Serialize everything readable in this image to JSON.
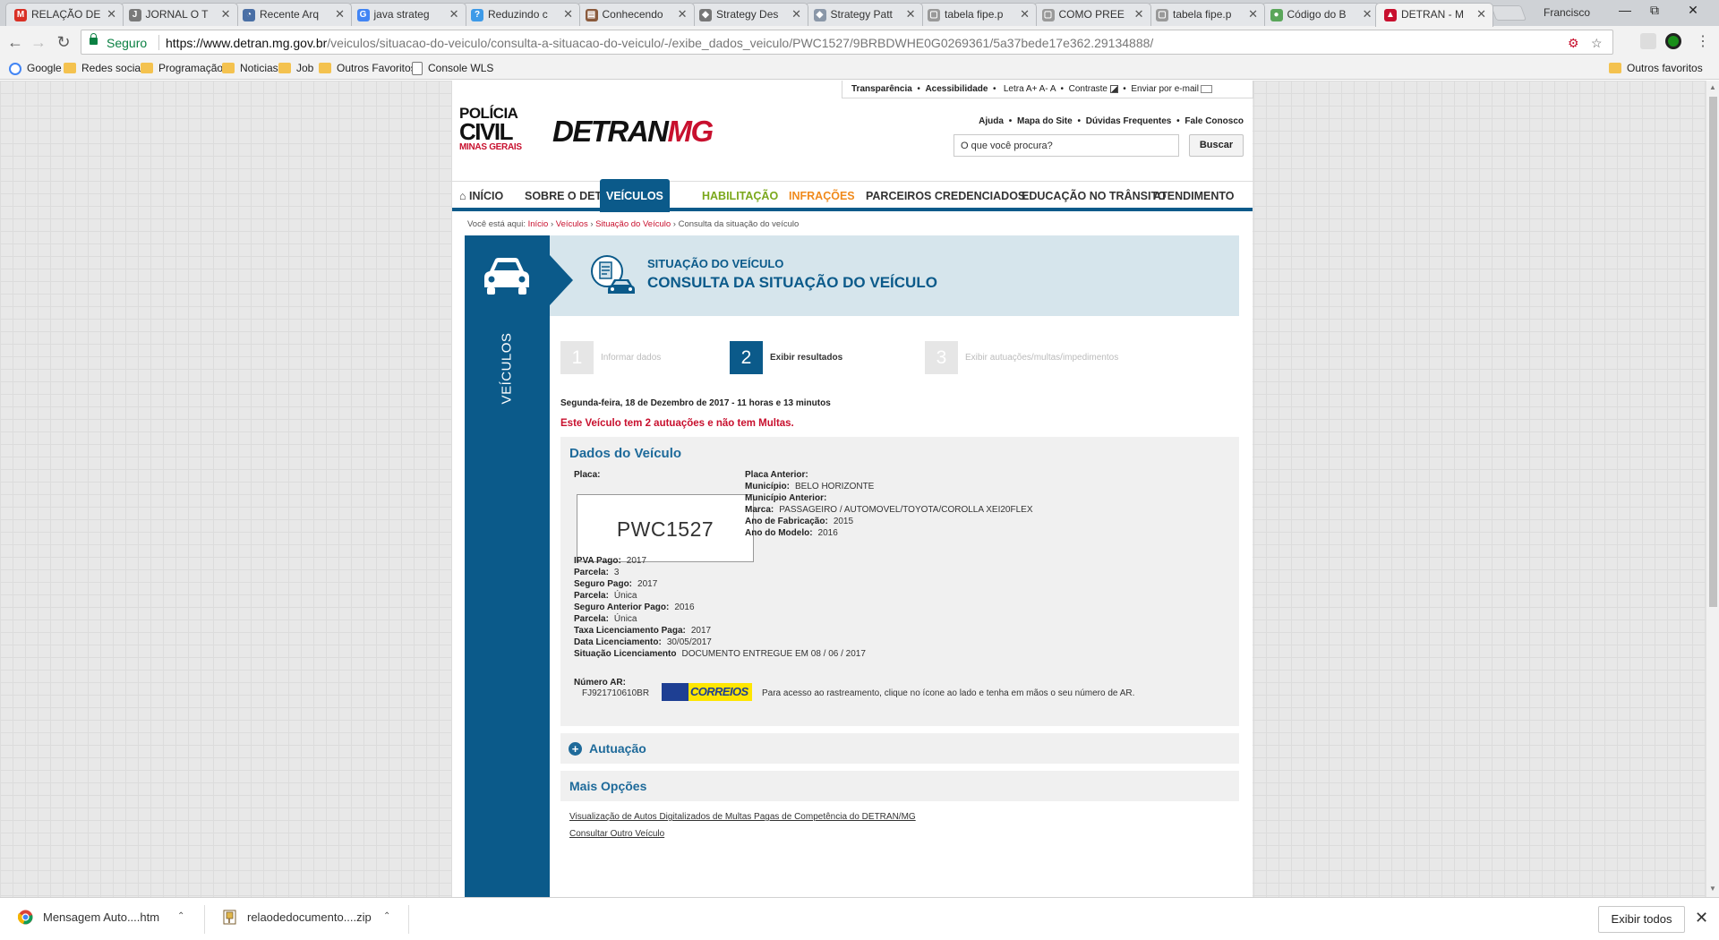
{
  "browser": {
    "tabs": [
      {
        "title": "RELAÇÃO DE",
        "icon": "gmail-icon",
        "glyph": "M",
        "color": "#d93025"
      },
      {
        "title": "JORNAL O T",
        "icon": "page-icon",
        "glyph": "J",
        "color": "#7a7a7a"
      },
      {
        "title": "Recente Arq",
        "icon": "drive-icon",
        "glyph": "◔",
        "color": "#4a6fa5"
      },
      {
        "title": "java strateg",
        "icon": "google-icon",
        "glyph": "G",
        "color": "#4285f4"
      },
      {
        "title": "Reduzindo c",
        "icon": "doc-icon",
        "glyph": "?",
        "color": "#3d9ae8"
      },
      {
        "title": "Conhecendo",
        "icon": "book-icon",
        "glyph": "▤",
        "color": "#8a5a3c"
      },
      {
        "title": "Strategy Des",
        "icon": "pattern-icon",
        "glyph": "◆",
        "color": "#777777"
      },
      {
        "title": "Strategy Patt",
        "icon": "pattern-icon",
        "glyph": "◆",
        "color": "#8a97a8"
      },
      {
        "title": "tabela fipe.p",
        "icon": "file-icon",
        "glyph": "▢",
        "color": "#999999"
      },
      {
        "title": "COMO PREE",
        "icon": "file-icon",
        "glyph": "▢",
        "color": "#999999"
      },
      {
        "title": "tabela fipe.p",
        "icon": "file-icon",
        "glyph": "▢",
        "color": "#999999"
      },
      {
        "title": "Código do B",
        "icon": "globe-icon",
        "glyph": "●",
        "color": "#5aa65a"
      },
      {
        "title": "DETRAN - M",
        "icon": "detran-icon",
        "glyph": "▲",
        "color": "#c8102e"
      }
    ],
    "profile_name": "Francisco",
    "secure_label": "Seguro",
    "url_domain": "https://www.detran.mg.gov.br",
    "url_path": "/veiculos/situacao-do-veiculo/consulta-a-situacao-do-veiculo/-/exibe_dados_veiculo/PWC1527/9BRBDWHE0G0269361/5a37bede17e362.29134888/",
    "bookmarks": [
      {
        "label": "Google",
        "kind": "google"
      },
      {
        "label": "Redes sociais",
        "kind": "folder"
      },
      {
        "label": "Programação",
        "kind": "folder"
      },
      {
        "label": "Noticias",
        "kind": "folder"
      },
      {
        "label": "Job",
        "kind": "folder"
      },
      {
        "label": "Outros Favoritos",
        "kind": "folder"
      },
      {
        "label": "Console WLS",
        "kind": "page"
      }
    ],
    "other_bookmarks": "Outros favoritos"
  },
  "site": {
    "toplinks": {
      "transparencia": "Transparência",
      "acessibilidade": "Acessibilidade",
      "letra": "Letra A+ A- A",
      "contraste": "Contraste",
      "email": "Enviar por e-mail"
    },
    "logo": {
      "pc_line1": "POLÍCIA",
      "pc_line2": "CIVIL",
      "pc_line3": "MINAS GERAIS",
      "detran_a": "DETRAN",
      "detran_b": "MG"
    },
    "helplinks": [
      "Ajuda",
      "Mapa do Site",
      "Dúvidas Frequentes",
      "Fale Conosco"
    ],
    "search": {
      "value": "O que você procura?",
      "button": "Buscar"
    },
    "nav": [
      "INÍCIO",
      "SOBRE O DETRAN",
      "VEÍCULOS",
      "HABILITAÇÃO",
      "INFRAÇÕES",
      "PARCEIROS CREDENCIADOS",
      "EDUCAÇÃO NO TRÂNSITO",
      "ATENDIMENTO"
    ],
    "breadcrumb": {
      "prefix": "Você está aqui:",
      "items": [
        "Início",
        "Veículos",
        "Situação do Veículo"
      ],
      "current": "Consulta da situação do veículo"
    },
    "sidebar_label": "VEÍCULOS",
    "banner": {
      "title": "SITUAÇÃO DO VEÍCULO",
      "subtitle": "CONSULTA DA SITUAÇÃO DO VEÍCULO"
    },
    "steps": [
      {
        "num": "1",
        "label": "Informar dados"
      },
      {
        "num": "2",
        "label": "Exibir resultados"
      },
      {
        "num": "3",
        "label": "Exibir autuações/multas/impedimentos"
      }
    ],
    "datetime": "Segunda-feira, 18 de Dezembro de 2017 - 11 horas e 13 minutos",
    "alert": "Este Veículo tem 2 autuações e não tem Multas.",
    "vehicle": {
      "section_title": "Dados do Veículo",
      "placa_label": "Placa:",
      "placa": "PWC1527",
      "right_fields": [
        {
          "label": "Placa Anterior:",
          "value": ""
        },
        {
          "label": "Município:",
          "value": "BELO HORIZONTE"
        },
        {
          "label": "Município Anterior:",
          "value": ""
        },
        {
          "label": "Marca:",
          "value": "PASSAGEIRO / AUTOMOVEL/TOYOTA/COROLLA XEI20FLEX"
        },
        {
          "label": "Ano de Fabricação:",
          "value": "2015"
        },
        {
          "label": "Ano do Modelo:",
          "value": "2016"
        }
      ],
      "left_fields": [
        {
          "label": "IPVA Pago:",
          "value": "2017"
        },
        {
          "label": "Parcela:",
          "value": "3"
        },
        {
          "label": "Seguro Pago:",
          "value": "2017"
        },
        {
          "label": "Parcela:",
          "value": "Única"
        },
        {
          "label": "Seguro Anterior Pago:",
          "value": "2016"
        },
        {
          "label": "Parcela:",
          "value": "Única"
        },
        {
          "label": "Taxa Licenciamento Paga:",
          "value": "2017"
        },
        {
          "label": "Data Licenciamento:",
          "value": "30/05/2017"
        },
        {
          "label": "Situação Licenciamento",
          "value": "DOCUMENTO ENTREGUE EM 08 / 06 / 2017"
        }
      ],
      "ar_label": "Número AR:",
      "ar_number": "FJ921710610BR",
      "correios": "CORREIOS",
      "ar_help": "Para acesso ao rastreamento, clique no ícone ao lado e tenha em mãos o seu número de AR."
    },
    "autuacao_title": "Autuação",
    "mais_opcoes_title": "Mais Opções",
    "options": [
      "Visualização de Autos Digitalizados de Multas Pagas de Competência do DETRAN/MG",
      "Consultar Outro Veículo"
    ]
  },
  "downloads": {
    "items": [
      "Mensagem Auto....htm",
      "relaodedocumento....zip"
    ],
    "show_all": "Exibir todos"
  }
}
